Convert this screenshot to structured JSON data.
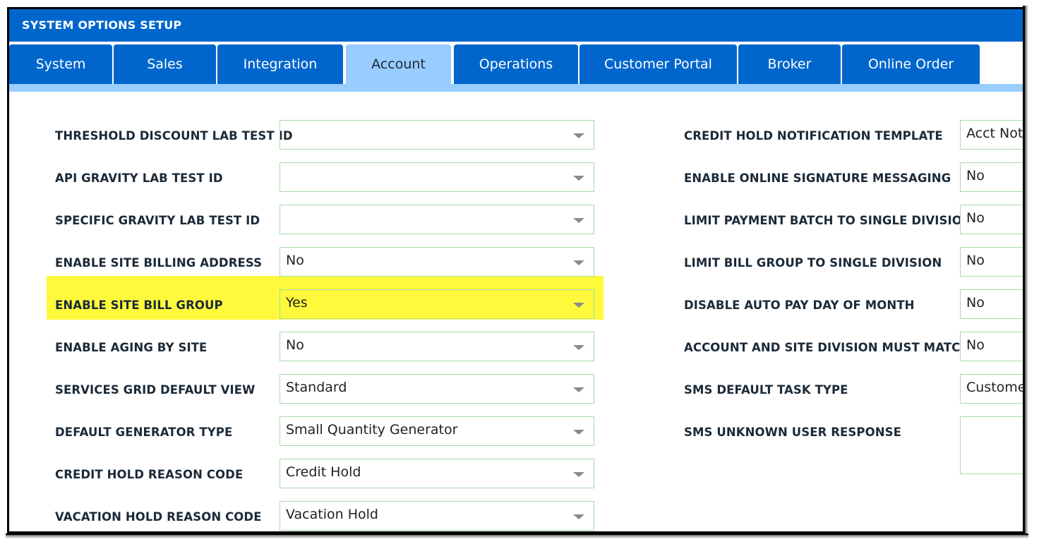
{
  "header": {
    "title": "SYSTEM OPTIONS SETUP"
  },
  "tabs": [
    {
      "label": "System"
    },
    {
      "label": "Sales"
    },
    {
      "label": "Integration"
    },
    {
      "label": "Account",
      "active": true
    },
    {
      "label": "Operations"
    },
    {
      "label": "Customer Portal"
    },
    {
      "label": "Broker"
    },
    {
      "label": "Online Order"
    }
  ],
  "left_fields": [
    {
      "label": "THRESHOLD DISCOUNT LAB TEST ID",
      "value": ""
    },
    {
      "label": "API GRAVITY LAB TEST ID",
      "value": ""
    },
    {
      "label": "SPECIFIC GRAVITY LAB TEST ID",
      "value": ""
    },
    {
      "label": "ENABLE SITE BILLING ADDRESS",
      "value": "No"
    },
    {
      "label": "ENABLE SITE BILL GROUP",
      "value": "Yes",
      "highlighted": true
    },
    {
      "label": "ENABLE AGING BY SITE",
      "value": "No"
    },
    {
      "label": "SERVICES GRID DEFAULT VIEW",
      "value": "Standard"
    },
    {
      "label": "DEFAULT GENERATOR TYPE",
      "value": "Small Quantity Generator"
    },
    {
      "label": "CREDIT HOLD REASON CODE",
      "value": "Credit Hold"
    },
    {
      "label": "VACATION HOLD REASON CODE",
      "value": "Vacation Hold"
    }
  ],
  "right_fields": [
    {
      "label": "CREDIT HOLD NOTIFICATION TEMPLATE",
      "value": "Acct Not"
    },
    {
      "label": "ENABLE ONLINE SIGNATURE MESSAGING",
      "value": "No"
    },
    {
      "label": "LIMIT PAYMENT BATCH TO SINGLE DIVISION",
      "value": "No"
    },
    {
      "label": "LIMIT BILL GROUP TO SINGLE DIVISION",
      "value": "No"
    },
    {
      "label": "DISABLE AUTO PAY DAY OF MONTH",
      "value": "No"
    },
    {
      "label": "ACCOUNT AND SITE DIVISION MUST MATCH",
      "value": "No"
    },
    {
      "label": "SMS DEFAULT TASK TYPE",
      "value": "Custome"
    },
    {
      "label": "SMS UNKNOWN USER RESPONSE",
      "value": ""
    }
  ],
  "colors": {
    "header_bg": "#0066cc",
    "tab_active_bg": "#99ccff",
    "highlight": "#fff93c",
    "field_border": "#a9d9a9"
  }
}
